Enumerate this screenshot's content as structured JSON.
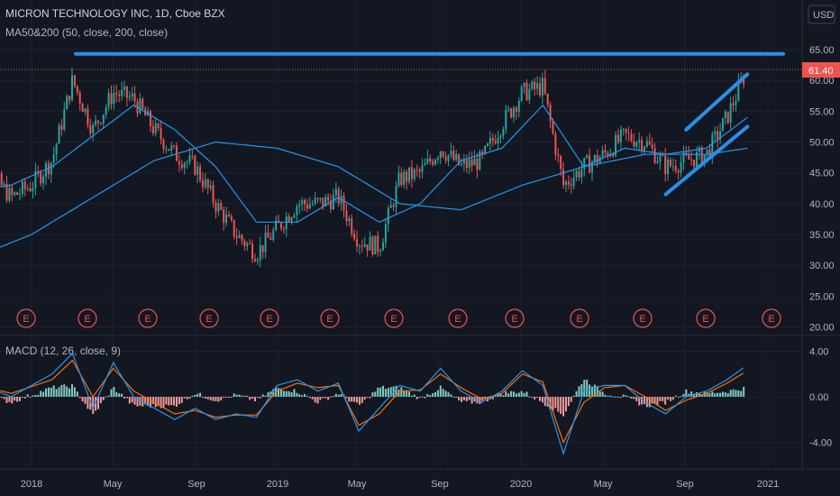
{
  "header": {
    "title": "MICRON TECHNOLOGY INC, 1D, Cboe BZX",
    "indicator": "MA50&200 (50, close, 200, close)",
    "currency": "USD"
  },
  "price_badge": "61.40",
  "macd_label": "MACD (12, 26, close, 9)",
  "colors": {
    "background": "#131722",
    "up": "#26a69a",
    "down": "#ef5350",
    "ma": "#2196f3",
    "trendline": "#2a8fe8",
    "earnings": "#ef5350",
    "macd_line": "#2196f3",
    "signal_line": "#ff6d00"
  },
  "chart_data": [
    {
      "type": "line",
      "title": "MICRON TECHNOLOGY INC, 1D, Cboe BZX",
      "x_ticks": [
        "2018",
        "May",
        "Sep",
        "2019",
        "May",
        "Sep",
        "2020",
        "May",
        "Sep",
        "2021"
      ],
      "y_ticks": [
        "65.00",
        "60.00",
        "55.00",
        "50.00",
        "45.00",
        "40.00",
        "35.00",
        "30.00",
        "25.00",
        "20.00"
      ],
      "ylim": [
        20,
        66
      ],
      "last_price": 61.4,
      "earnings_marker": "E",
      "earnings_dates": [
        "2017-12",
        "2018-03",
        "2018-06",
        "2018-09",
        "2018-12",
        "2019-03",
        "2019-06",
        "2019-09",
        "2019-12",
        "2020-03",
        "2020-06",
        "2020-09",
        "2020-12"
      ],
      "series": [
        {
          "name": "Close",
          "x": [
            "2017-10",
            "2017-11",
            "2017-12",
            "2018-01",
            "2018-02",
            "2018-03",
            "2018-04",
            "2018-05",
            "2018-06",
            "2018-07",
            "2018-08",
            "2018-09",
            "2018-10",
            "2018-11",
            "2018-12",
            "2019-01",
            "2019-02",
            "2019-03",
            "2019-04",
            "2019-05",
            "2019-06",
            "2019-07",
            "2019-08",
            "2019-09",
            "2019-10",
            "2019-11",
            "2019-12",
            "2020-01",
            "2020-02",
            "2020-03",
            "2020-04",
            "2020-05",
            "2020-06",
            "2020-07",
            "2020-08",
            "2020-09",
            "2020-10",
            "2020-11",
            "2020-12"
          ],
          "values": [
            41,
            45,
            41,
            43,
            47,
            60,
            52,
            58,
            57,
            52,
            48,
            46,
            40,
            35,
            32,
            36,
            40,
            40,
            41,
            34,
            33,
            44,
            45,
            49,
            46,
            47,
            53,
            58,
            59,
            43,
            46,
            48,
            51,
            50,
            46,
            47,
            48,
            54,
            62
          ]
        },
        {
          "name": "MA50",
          "x": [
            "2017-10",
            "2017-12",
            "2018-02",
            "2018-04",
            "2018-06",
            "2018-08",
            "2018-10",
            "2018-12",
            "2019-02",
            "2019-04",
            "2019-06",
            "2019-08",
            "2019-10",
            "2019-12",
            "2020-02",
            "2020-04",
            "2020-06",
            "2020-08",
            "2020-10",
            "2020-12"
          ],
          "values": [
            42,
            43,
            46,
            51,
            56,
            52,
            46,
            37,
            37,
            41,
            37,
            40,
            47,
            49,
            56,
            46,
            49,
            48,
            49,
            54
          ]
        },
        {
          "name": "MA200",
          "x": [
            "2017-10",
            "2018-01",
            "2018-04",
            "2018-07",
            "2018-10",
            "2019-01",
            "2019-04",
            "2019-07",
            "2019-10",
            "2020-01",
            "2020-04",
            "2020-07",
            "2020-10",
            "2020-12"
          ],
          "values": [
            31,
            35,
            41,
            47,
            50,
            49,
            46,
            40,
            39,
            43,
            46,
            48,
            48,
            49
          ]
        }
      ],
      "annotations": [
        {
          "type": "horizontal_resistance",
          "value": 64.3
        },
        {
          "type": "channel_upper",
          "from": [
            "2020-09",
            52
          ],
          "to": [
            "2020-12",
            61
          ]
        },
        {
          "type": "channel_lower",
          "from": [
            "2020-08",
            41.5
          ],
          "to": [
            "2020-12",
            52.5
          ]
        }
      ]
    },
    {
      "type": "line",
      "title": "MACD (12, 26, close, 9)",
      "y_ticks": [
        "4.00",
        "0.00",
        "-4.00"
      ],
      "ylim": [
        -6,
        5
      ],
      "series": [
        {
          "name": "MACD",
          "x": [
            "2017-10",
            "2017-12",
            "2018-02",
            "2018-03",
            "2018-04",
            "2018-05",
            "2018-06",
            "2018-07",
            "2018-08",
            "2018-09",
            "2018-10",
            "2018-11",
            "2018-12",
            "2019-01",
            "2019-02",
            "2019-03",
            "2019-04",
            "2019-05",
            "2019-06",
            "2019-07",
            "2019-08",
            "2019-09",
            "2019-10",
            "2019-11",
            "2019-12",
            "2020-01",
            "2020-02",
            "2020-03",
            "2020-04",
            "2020-05",
            "2020-06",
            "2020-07",
            "2020-08",
            "2020-09",
            "2020-10",
            "2020-11",
            "2020-12"
          ],
          "values": [
            1.5,
            0,
            2,
            3.8,
            -1,
            3,
            0,
            -1,
            -2,
            -1,
            -2,
            -1.5,
            -1.8,
            1,
            1.5,
            0.5,
            1.2,
            -3,
            -1,
            1,
            0.5,
            2.5,
            0.5,
            -0.5,
            0.5,
            2.3,
            1,
            -5,
            0.5,
            1,
            1,
            -0.5,
            -1.5,
            0,
            0.5,
            1.5,
            2.8
          ]
        },
        {
          "name": "Signal",
          "x": [
            "2017-10",
            "2017-12",
            "2018-02",
            "2018-03",
            "2018-04",
            "2018-05",
            "2018-06",
            "2018-07",
            "2018-08",
            "2018-09",
            "2018-10",
            "2018-11",
            "2018-12",
            "2019-01",
            "2019-02",
            "2019-03",
            "2019-04",
            "2019-05",
            "2019-06",
            "2019-07",
            "2019-08",
            "2019-09",
            "2019-10",
            "2019-11",
            "2019-12",
            "2020-01",
            "2020-02",
            "2020-03",
            "2020-04",
            "2020-05",
            "2020-06",
            "2020-07",
            "2020-08",
            "2020-09",
            "2020-10",
            "2020-11",
            "2020-12"
          ],
          "values": [
            1.2,
            0.3,
            1.5,
            3.2,
            0,
            2.5,
            0.5,
            -0.5,
            -1.5,
            -1.2,
            -1.8,
            -1.6,
            -1.6,
            0.5,
            1.2,
            0.8,
            1,
            -2.5,
            -1.5,
            0.5,
            0.6,
            2,
            0.8,
            -0.2,
            0.3,
            2,
            1.3,
            -4,
            -0.5,
            0.8,
            1,
            0,
            -1.2,
            -0.3,
            0.3,
            1.2,
            2.3
          ]
        }
      ]
    }
  ]
}
